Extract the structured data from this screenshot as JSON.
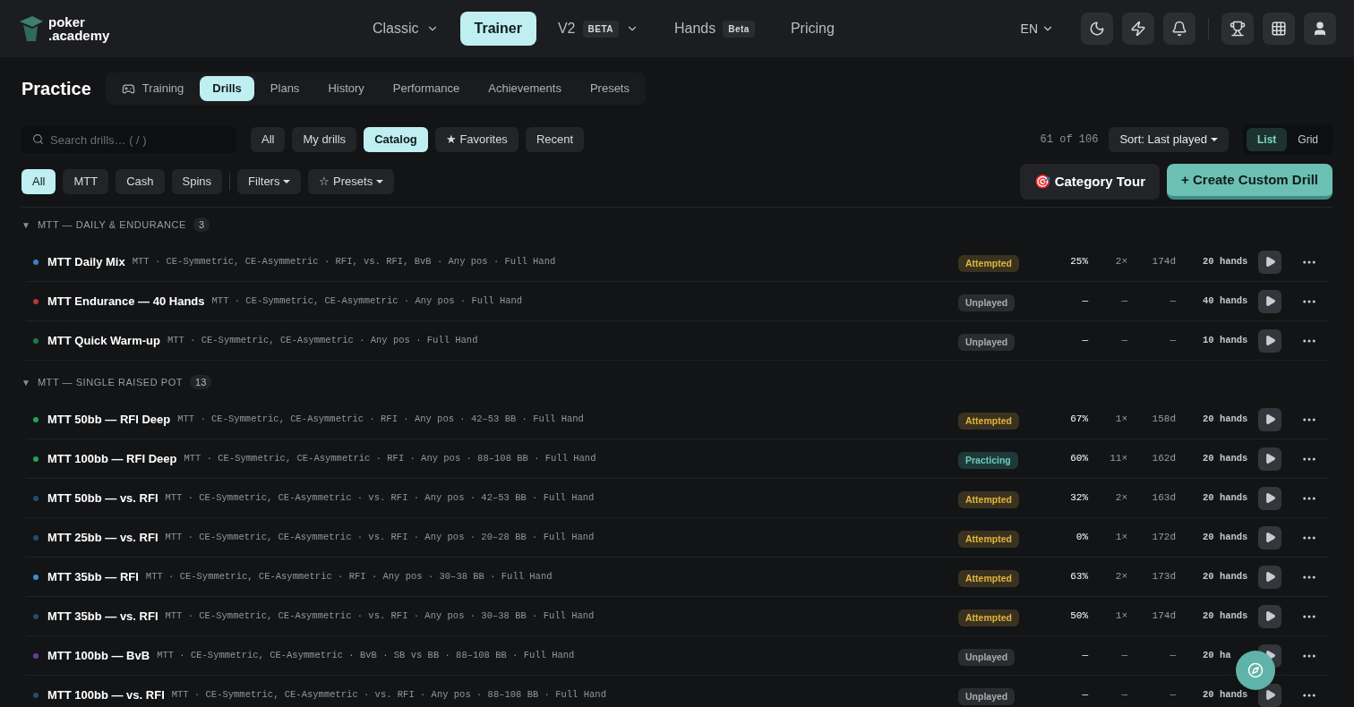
{
  "brand": {
    "line1": "poker",
    "line2": ".academy"
  },
  "nav": [
    {
      "label": "Classic",
      "selected": false,
      "dropdown": true
    },
    {
      "label": "Trainer",
      "selected": true,
      "dropdown": false
    },
    {
      "label": "V2",
      "badge": "BETA",
      "selected": false,
      "dropdown": true
    },
    {
      "label": "Hands",
      "badge": "Beta",
      "selected": false,
      "dropdown": false
    },
    {
      "label": "Pricing",
      "selected": false,
      "dropdown": false
    }
  ],
  "language": "EN",
  "header_icons": [
    {
      "kind": "moon"
    },
    {
      "kind": "bolt"
    },
    {
      "kind": "bell"
    },
    {
      "kind": "divider"
    },
    {
      "kind": "trophy"
    },
    {
      "kind": "grid"
    },
    {
      "kind": "user"
    }
  ],
  "page_title": "Practice",
  "tabs": [
    {
      "label": "Training",
      "icon": true,
      "selected": false
    },
    {
      "label": "Drills",
      "selected": true
    },
    {
      "label": "Plans",
      "selected": false
    },
    {
      "label": "History",
      "selected": false
    },
    {
      "label": "Performance",
      "selected": false
    },
    {
      "label": "Achievements",
      "selected": false
    },
    {
      "label": "Presets",
      "selected": false
    }
  ],
  "search": {
    "placeholder": "Search drills… ( / )"
  },
  "source_filters": [
    {
      "label": "All",
      "selected": false
    },
    {
      "label": "My drills",
      "selected": false
    },
    {
      "label": "Catalog",
      "selected": true
    },
    {
      "label": "★ Favorites",
      "selected": false
    },
    {
      "label": "Recent",
      "selected": false
    }
  ],
  "count": "61 of 106",
  "sort": "Sort: Last played",
  "view_toggle": [
    {
      "label": "List",
      "selected": true
    },
    {
      "label": "Grid",
      "selected": false
    }
  ],
  "game_filters": [
    {
      "label": "All",
      "selected": true
    },
    {
      "label": "MTT",
      "selected": false
    },
    {
      "label": "Cash",
      "selected": false
    },
    {
      "label": "Spins",
      "selected": false
    }
  ],
  "dropdowns": [
    "Filters",
    "☆ Presets"
  ],
  "category_tour": {
    "emoji": "🎯",
    "label": "Category Tour"
  },
  "create_button": "+ Create Custom Drill",
  "groups": [
    {
      "toggle": "▼",
      "title": "MTT — DAILY & ENDURANCE",
      "count": "3",
      "expanded": true,
      "rows": [
        {
          "name": "MTT Daily Mix",
          "meta": "MTT · CE-Symmetric, CE-Asymmetric · RFI, vs. RFI, BvB · Any pos · Full Hand",
          "color": "#3b82c4",
          "status": "Attempted",
          "kind": "attempted",
          "accuracy": "25%",
          "plays": "2×",
          "age": "174d",
          "hands": "20 hands"
        },
        {
          "name": "MTT Endurance — 40 Hands",
          "meta": "MTT · CE-Symmetric, CE-Asymmetric · Any pos · Full Hand",
          "color": "#b03a32",
          "status": "Unplayed",
          "kind": "unplayed",
          "accuracy": "—",
          "plays": "—",
          "age": "—",
          "hands": "40 hands"
        },
        {
          "name": "MTT Quick Warm-up",
          "meta": "MTT · CE-Symmetric, CE-Asymmetric · Any pos · Full Hand",
          "color": "#1f7a4a",
          "status": "Unplayed",
          "kind": "unplayed",
          "accuracy": "—",
          "plays": "—",
          "age": "—",
          "hands": "10 hands"
        }
      ]
    },
    {
      "toggle": "▼",
      "title": "MTT — SINGLE RAISED POT",
      "count": "13",
      "expanded": true,
      "rows": [
        {
          "name": "MTT 50bb — RFI Deep",
          "meta": "MTT · CE-Symmetric, CE-Asymmetric · RFI · Any pos · 42–53 BB · Full Hand",
          "color": "#22a35a",
          "status": "Attempted",
          "kind": "attempted",
          "accuracy": "67%",
          "plays": "1×",
          "age": "158d",
          "hands": "20 hands"
        },
        {
          "name": "MTT 100bb — RFI Deep",
          "meta": "MTT · CE-Symmetric, CE-Asymmetric · RFI · Any pos · 88–108 BB · Full Hand",
          "color": "#22a35a",
          "status": "Practicing",
          "kind": "practicing",
          "accuracy": "60%",
          "plays": "11×",
          "age": "162d",
          "hands": "20 hands"
        },
        {
          "name": "MTT 50bb — vs. RFI",
          "meta": "MTT · CE-Symmetric, CE-Asymmetric · vs. RFI · Any pos · 42–53 BB · Full Hand",
          "color": "#1e4f75",
          "status": "Attempted",
          "kind": "attempted",
          "accuracy": "32%",
          "plays": "2×",
          "age": "163d",
          "hands": "20 hands"
        },
        {
          "name": "MTT 25bb — vs. RFI",
          "meta": "MTT · CE-Symmetric, CE-Asymmetric · vs. RFI · Any pos · 20–28 BB · Full Hand",
          "color": "#1e4f75",
          "status": "Attempted",
          "kind": "attempted",
          "accuracy": "0%",
          "plays": "1×",
          "age": "172d",
          "hands": "20 hands"
        },
        {
          "name": "MTT 35bb — RFI",
          "meta": "MTT · CE-Symmetric, CE-Asymmetric · RFI · Any pos · 30–38 BB · Full Hand",
          "color": "#3b8fd0",
          "status": "Attempted",
          "kind": "attempted",
          "accuracy": "63%",
          "plays": "2×",
          "age": "173d",
          "hands": "20 hands"
        },
        {
          "name": "MTT 35bb — vs. RFI",
          "meta": "MTT · CE-Symmetric, CE-Asymmetric · vs. RFI · Any pos · 30–38 BB · Full Hand",
          "color": "#1e4f75",
          "status": "Attempted",
          "kind": "attempted",
          "accuracy": "50%",
          "plays": "1×",
          "age": "174d",
          "hands": "20 hands"
        },
        {
          "name": "MTT 100bb — BvB",
          "meta": "MTT · CE-Symmetric, CE-Asymmetric · BvB · SB vs BB · 88–108 BB · Full Hand",
          "color": "#6a3ba0",
          "status": "Unplayed",
          "kind": "unplayed",
          "accuracy": "—",
          "plays": "—",
          "age": "—",
          "hands": "20 ha"
        },
        {
          "name": "MTT 100bb — vs. RFI",
          "meta": "MTT · CE-Symmetric, CE-Asymmetric · vs. RFI · Any pos · 88–108 BB · Full Hand",
          "color": "#1e4f75",
          "status": "Unplayed",
          "kind": "unplayed",
          "accuracy": "—",
          "plays": "—",
          "age": "—",
          "hands": "20 hands"
        }
      ]
    }
  ],
  "fab": {
    "kind": "compass"
  }
}
